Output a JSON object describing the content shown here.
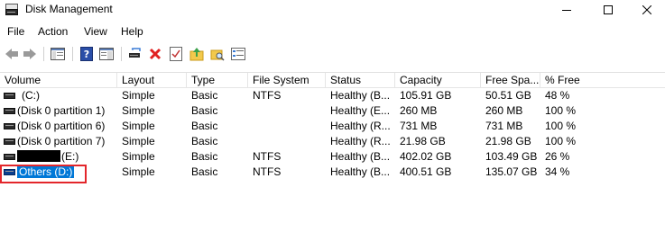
{
  "window": {
    "title": "Disk Management",
    "controls": {
      "minimize": "–",
      "maximize": "☐",
      "close": "✕"
    }
  },
  "menu": [
    "File",
    "Action",
    "View",
    "Help"
  ],
  "toolbar": {
    "icons": [
      "back-icon",
      "forward-icon",
      "console-tree-icon",
      "help-icon",
      "properties-icon",
      "connect-drive-icon",
      "delete-icon",
      "checklist-icon",
      "folder-up-icon",
      "search-folder-icon",
      "settings-list-icon"
    ]
  },
  "colors": {
    "selection": "#0078d7",
    "highlight_box": "#e3262b",
    "delete_icon": "#e02020"
  },
  "table": {
    "columns": [
      "Volume",
      "Layout",
      "Type",
      "File System",
      "Status",
      "Capacity",
      "Free Spa...",
      "% Free"
    ],
    "rows": [
      {
        "volume": "(C:)",
        "layout": "Simple",
        "type": "Basic",
        "fs": "NTFS",
        "status": "Healthy (B...",
        "capacity": "105.91 GB",
        "free": "50.51 GB",
        "pct": "48 %"
      },
      {
        "volume": "(Disk 0 partition 1)",
        "layout": "Simple",
        "type": "Basic",
        "fs": "",
        "status": "Healthy (E...",
        "capacity": "260 MB",
        "free": "260 MB",
        "pct": "100 %"
      },
      {
        "volume": "(Disk 0 partition 6)",
        "layout": "Simple",
        "type": "Basic",
        "fs": "",
        "status": "Healthy (R...",
        "capacity": "731 MB",
        "free": "731 MB",
        "pct": "100 %"
      },
      {
        "volume": "(Disk 0 partition 7)",
        "layout": "Simple",
        "type": "Basic",
        "fs": "",
        "status": "Healthy (R...",
        "capacity": "21.98 GB",
        "free": "21.98 GB",
        "pct": "100 %"
      },
      {
        "volume": "(E:)",
        "layout": "Simple",
        "type": "Basic",
        "fs": "NTFS",
        "status": "Healthy (B...",
        "capacity": "402.02 GB",
        "free": "103.49 GB",
        "pct": "26 %"
      },
      {
        "volume": "Others (D:)",
        "layout": "Simple",
        "type": "Basic",
        "fs": "NTFS",
        "status": "Healthy (B...",
        "capacity": "400.51 GB",
        "free": "135.07 GB",
        "pct": "34 %"
      }
    ]
  }
}
